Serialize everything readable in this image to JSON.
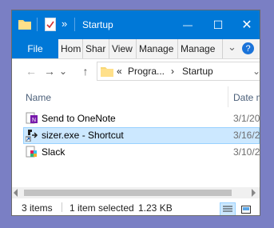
{
  "window": {
    "title": "Startup",
    "minimize_glyph": "—",
    "maximize_glyph": "☐",
    "close_glyph": "✕"
  },
  "qat": {
    "overflow_glyph": "»"
  },
  "ribbon": {
    "file": "File",
    "tabs": [
      "Hom",
      "Shar",
      "View",
      "Manage",
      "Manage"
    ],
    "collapse_glyph": "⌄",
    "help_glyph": "?"
  },
  "nav": {
    "back": "←",
    "forward": "→",
    "recent": "⌄",
    "up": "↑"
  },
  "address": {
    "overflow": "«",
    "crumbs": [
      "Progra...",
      "Startup"
    ],
    "sep": "›",
    "dropdown": "⌄"
  },
  "columns": {
    "name": "Name",
    "date": "Date m"
  },
  "files": [
    {
      "name": "Send to OneNote",
      "date": "3/1/20",
      "icon": "onenote-shortcut-icon",
      "selected": false
    },
    {
      "name": "sizer.exe - Shortcut",
      "date": "3/16/2",
      "icon": "sizer-shortcut-icon",
      "selected": true
    },
    {
      "name": "Slack",
      "date": "3/10/2",
      "icon": "slack-icon",
      "selected": false
    }
  ],
  "status": {
    "count": "3 items",
    "selection": "1 item selected",
    "size": "1.23 KB"
  },
  "colors": {
    "accent": "#0078d7",
    "selection_bg": "#cce8ff",
    "selection_border": "#99d1ff"
  }
}
